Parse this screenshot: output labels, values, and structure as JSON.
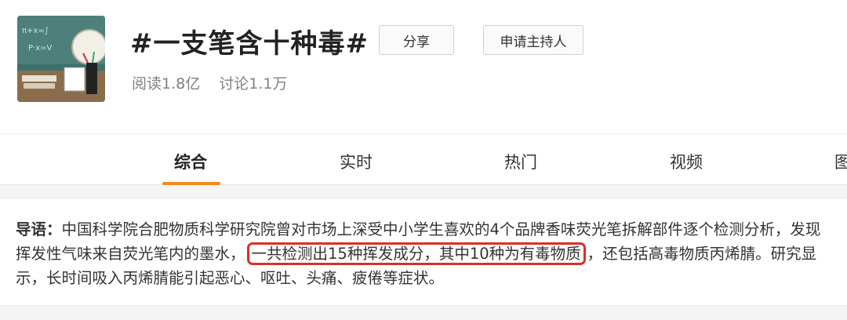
{
  "topic": {
    "title": "#一支笔含十种毒#",
    "stats": {
      "reads": "阅读1.8亿",
      "discussions": "讨论1.1万"
    },
    "buttons": {
      "share": "分享",
      "apply_host": "申请主持人"
    }
  },
  "tabs": [
    {
      "label": "综合",
      "active": true
    },
    {
      "label": "实时",
      "active": false
    },
    {
      "label": "热门",
      "active": false
    },
    {
      "label": "视频",
      "active": false
    },
    {
      "label": "图",
      "active": false
    }
  ],
  "intro": {
    "label": "导语：",
    "text_before": "中国科学院合肥物质科学研究院曾对市场上深受中小学生喜欢的4个品牌香味荧光笔拆解部件逐个检测分析，发现挥发性气味来自荧光笔内的墨水，",
    "highlighted": "一共检测出15种挥发成分，其中10种为有毒物质",
    "text_after": "，还包括高毒物质丙烯腈。研究显示，长时间吸入丙烯腈能引起恶心、呕吐、头痛、疲倦等症状。"
  },
  "colors": {
    "accent_tab": "#f28b1d",
    "highlight_border": "#d93025"
  }
}
